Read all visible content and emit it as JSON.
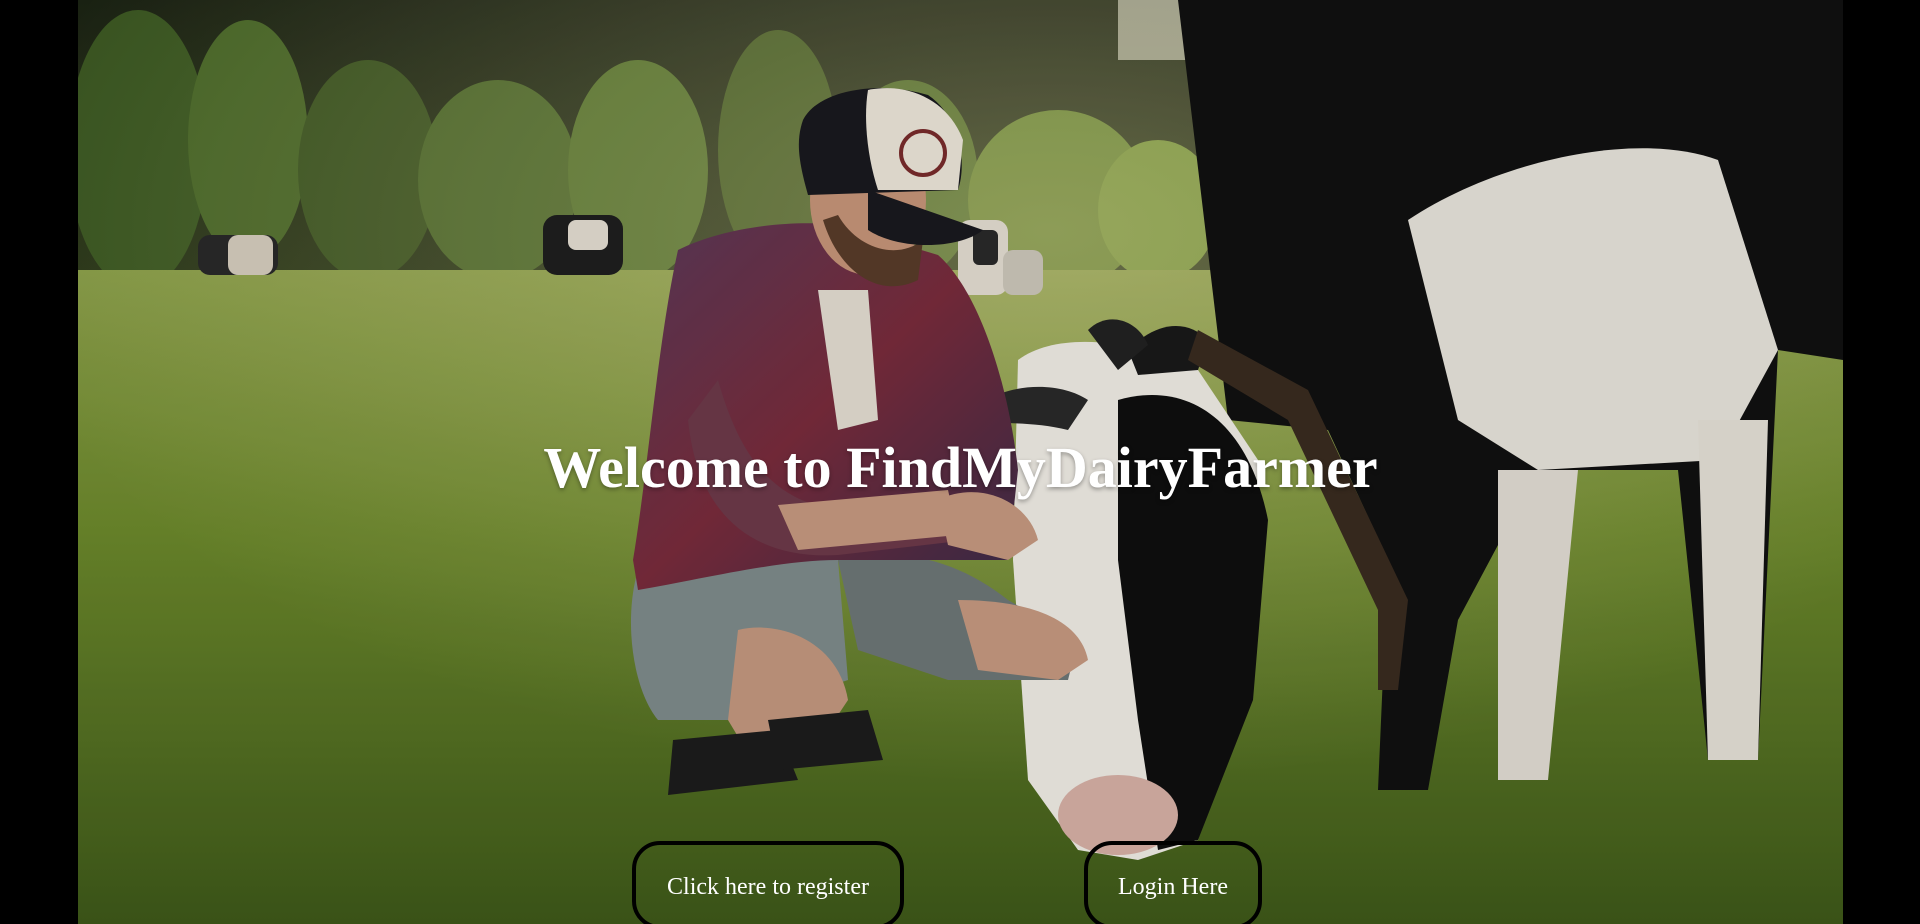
{
  "hero": {
    "image_description_icon": "farmer-and-cow-photo",
    "title": "Welcome to FindMyDairyFarmer"
  },
  "actions": {
    "register_label": "Click here to register",
    "login_label": "Login Here"
  },
  "colors": {
    "page_background": "#000000",
    "title_text": "#ffffff",
    "button_text": "#ffffff",
    "button_border": "#000000"
  }
}
